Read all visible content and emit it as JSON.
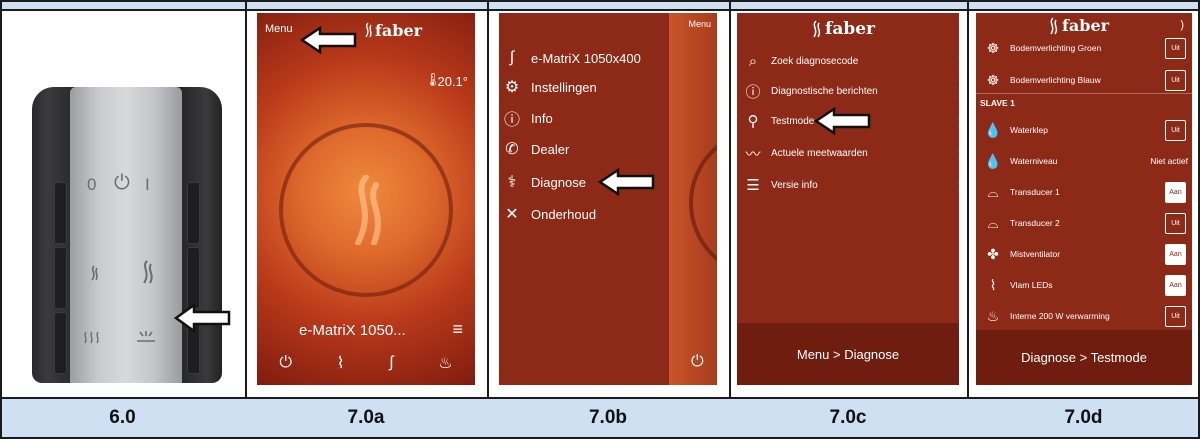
{
  "labels": [
    "6.0",
    "7.0a",
    "7.0b",
    "7.0c",
    "7.0d"
  ],
  "remote": {
    "row1": [
      "0",
      "⏻",
      "I"
    ]
  },
  "screen_a": {
    "menu_label": "Menu",
    "logo_text": "faber",
    "temperature": "20.1°",
    "device_name": "e-MatriX 1050...",
    "list_icon": "≡"
  },
  "screen_b": {
    "menu_label": "Menu",
    "items": [
      {
        "label": "e-MatriX 1050x400",
        "icon": "flame-icon"
      },
      {
        "label": "Instellingen",
        "icon": "gear-icon"
      },
      {
        "label": "Info",
        "icon": "info-icon"
      },
      {
        "label": "Dealer",
        "icon": "phone-icon"
      },
      {
        "label": "Diagnose",
        "icon": "stethoscope-icon"
      },
      {
        "label": "Onderhoud",
        "icon": "tools-icon"
      }
    ]
  },
  "screen_c": {
    "logo_text": "faber",
    "items": [
      {
        "label": "Zoek diagnosecode",
        "icon": "search-icon"
      },
      {
        "label": "Diagnostische berichten",
        "icon": "alert-icon"
      },
      {
        "label": "Testmode",
        "icon": "rocket-icon"
      },
      {
        "label": "Actuele meetwaarden",
        "icon": "graph-icon"
      },
      {
        "label": "Versie info",
        "icon": "database-icon"
      }
    ],
    "bottom": "Menu > Diagnose"
  },
  "screen_d": {
    "logo_text": "faber",
    "top_items": [
      {
        "label": "Bodemverlichting Groen",
        "state": "Uit"
      },
      {
        "label": "Bodemverlichting Blauw",
        "state": "Uit"
      }
    ],
    "section": "SLAVE 1",
    "items": [
      {
        "label": "Waterklep",
        "state": "Uit"
      },
      {
        "label": "Waterniveau",
        "state": "Niet actief"
      },
      {
        "label": "Transducer 1",
        "state": "Aan"
      },
      {
        "label": "Transducer 2",
        "state": "Uit"
      },
      {
        "label": "Mistventilator",
        "state": "Aan"
      },
      {
        "label": "Vlam LEDs",
        "state": "Aan"
      },
      {
        "label": "Interne 200 W verwarming",
        "state": "Uit"
      }
    ],
    "bottom": "Diagnose > Testmode"
  }
}
